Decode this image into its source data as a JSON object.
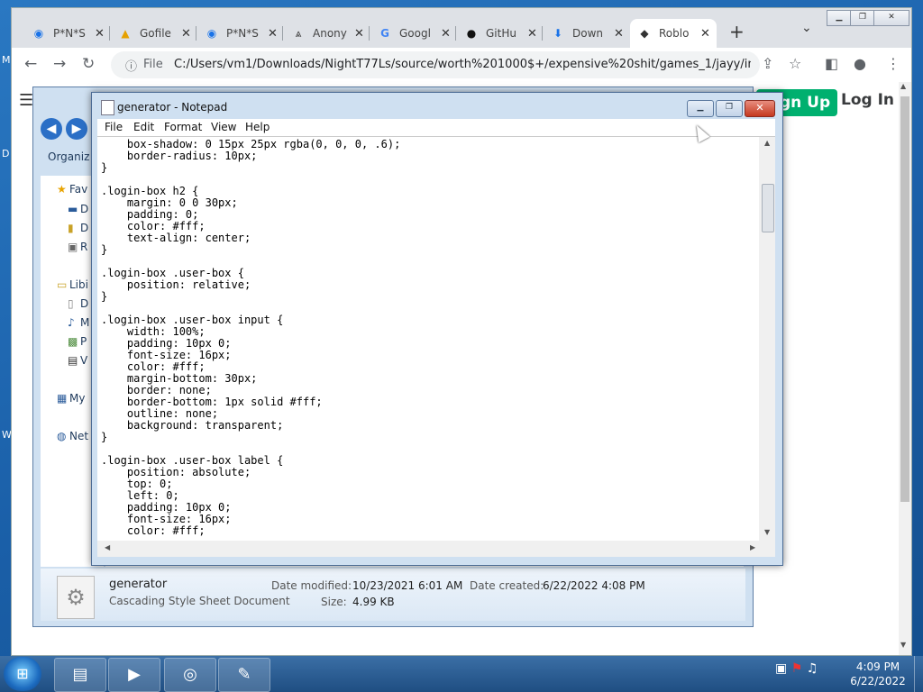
{
  "desktop": {
    "stubs": [
      "M",
      "D",
      "W"
    ]
  },
  "browser": {
    "tabs": [
      {
        "label": "P*N*S",
        "icon": "edge-blue-icon"
      },
      {
        "label": "Gofile",
        "icon": "gofile-icon"
      },
      {
        "label": "P*N*S",
        "icon": "edge-blue-icon"
      },
      {
        "label": "Anony",
        "icon": "anonymous-icon"
      },
      {
        "label": "Googl",
        "icon": "google-icon"
      },
      {
        "label": "GitHu",
        "icon": "github-icon"
      },
      {
        "label": "Down",
        "icon": "download-icon"
      },
      {
        "label": "Roblo",
        "icon": "roblox-icon"
      }
    ],
    "url_scheme": "File",
    "url": "C:/Users/vm1/Downloads/NightT77Ls/source/worth%201000$+/expensive%20shit/games_1/jayy/ind...",
    "page": {
      "signup": "Sign Up",
      "login": "Log In"
    }
  },
  "explorer": {
    "command_bar": "Organiz",
    "nav": [
      {
        "label": "Fav",
        "icon": "star-icon"
      },
      {
        "label": "D",
        "icon": "desktop-icon"
      },
      {
        "label": "D",
        "icon": "downloads-icon"
      },
      {
        "label": "R",
        "icon": "recent-places-icon"
      },
      {
        "label": "Libi",
        "icon": "libraries-icon"
      },
      {
        "label": "D",
        "icon": "documents-icon"
      },
      {
        "label": "M",
        "icon": "music-icon"
      },
      {
        "label": "P",
        "icon": "pictures-icon"
      },
      {
        "label": "V",
        "icon": "videos-icon"
      },
      {
        "label": "My",
        "icon": "computer-icon"
      },
      {
        "label": "Net",
        "icon": "network-icon"
      }
    ],
    "details": {
      "name": "generator",
      "type": "Cascading Style Sheet Document",
      "modified_label": "Date modified:",
      "modified": "10/23/2021 6:01 AM",
      "created_label": "Date created:",
      "created": "6/22/2022 4:08 PM",
      "size_label": "Size:",
      "size": "4.99 KB"
    }
  },
  "notepad": {
    "title": "generator - Notepad",
    "menu": [
      "File",
      "Edit",
      "Format",
      "View",
      "Help"
    ],
    "content": "    box-shadow: 0 15px 25px rgba(0, 0, 0, .6);\n    border-radius: 10px;\n}\n\n.login-box h2 {\n    margin: 0 0 30px;\n    padding: 0;\n    color: #fff;\n    text-align: center;\n}\n\n.login-box .user-box {\n    position: relative;\n}\n\n.login-box .user-box input {\n    width: 100%;\n    padding: 10px 0;\n    font-size: 16px;\n    color: #fff;\n    margin-bottom: 30px;\n    border: none;\n    border-bottom: 1px solid #fff;\n    outline: none;\n    background: transparent;\n}\n\n.login-box .user-box label {\n    position: absolute;\n    top: 0;\n    left: 0;\n    padding: 10px 0;\n    font-size: 16px;\n    color: #fff;"
  },
  "taskbar": {
    "apps": [
      "explorer-icon",
      "media-player-icon",
      "chrome-icon",
      "notepad-icon"
    ],
    "time": "4:09 PM",
    "date": "6/22/2022"
  }
}
